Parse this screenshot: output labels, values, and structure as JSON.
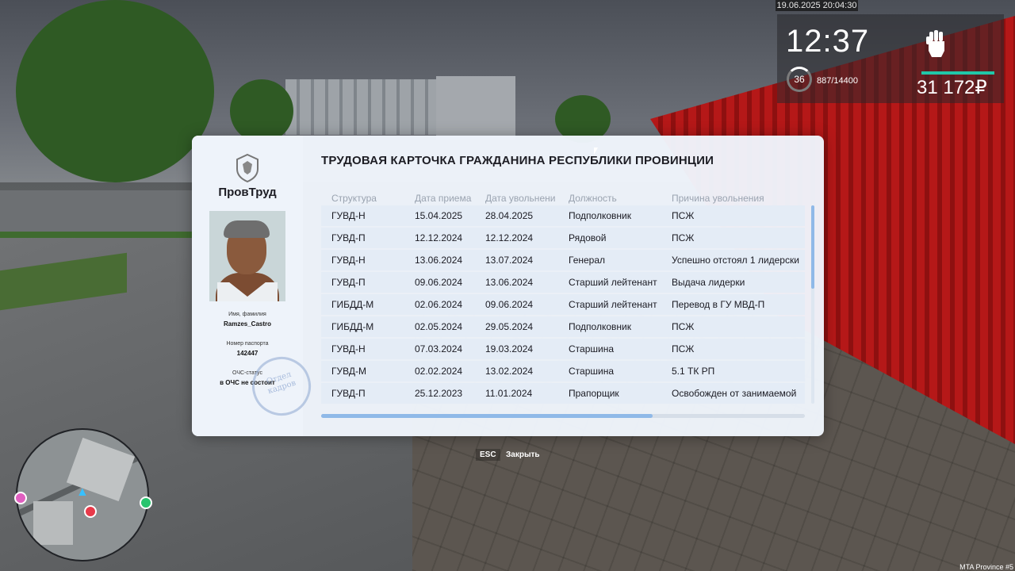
{
  "hud": {
    "datetime": "19.06.2025 20:04:30",
    "clock": "12:37",
    "level": "36",
    "exp": "887/14400",
    "money": "31 172₽"
  },
  "card": {
    "title": "ТРУДОВАЯ КАРТОЧКА ГРАЖДАНИНА РЕСПУБЛИКИ ПРОВИНЦИИ",
    "org": "ПровТруд",
    "name_label": "Имя, фамилия",
    "name_value": "Ramzes_Castro",
    "passport_label": "Номер паспорта",
    "passport_value": "142447",
    "ochs_label": "ОЧС-статус",
    "ochs_value": "в ОЧС не состоит",
    "stamp_line1": "Отдел",
    "stamp_line2": "кадров",
    "columns": [
      "Структура",
      "Дата приема",
      "Дата увольнени",
      "Должность",
      "Причина увольнения"
    ],
    "rows": [
      [
        "ГУВД-Н",
        "15.04.2025",
        "28.04.2025",
        "Подполковник",
        "ПСЖ"
      ],
      [
        "ГУВД-П",
        "12.12.2024",
        "12.12.2024",
        "Рядовой",
        "ПСЖ"
      ],
      [
        "ГУВД-Н",
        "13.06.2024",
        "13.07.2024",
        "Генерал",
        "Успешно отстоял 1 лидерски"
      ],
      [
        "ГУВД-П",
        "09.06.2024",
        "13.06.2024",
        "Старший лейтенант",
        "Выдача лидерки"
      ],
      [
        "ГИБДД-М",
        "02.06.2024",
        "09.06.2024",
        "Старший лейтенант",
        "Перевод в ГУ МВД-П"
      ],
      [
        "ГИБДД-М",
        "02.05.2024",
        "29.05.2024",
        "Подполковник",
        "ПСЖ"
      ],
      [
        "ГУВД-Н",
        "07.03.2024",
        "19.03.2024",
        "Старшина",
        "ПСЖ"
      ],
      [
        "ГУВД-М",
        "02.02.2024",
        "13.02.2024",
        "Старшина",
        "5.1 ТК РП"
      ],
      [
        "ГУВД-П",
        "25.12.2023",
        "11.01.2024",
        "Прапорщик",
        "Освобожден от занимаемой"
      ]
    ]
  },
  "footer": {
    "esc_key": "ESC",
    "esc_label": "Закрыть"
  },
  "server": "MTA Province #5",
  "colors": {
    "accent": "#8fb9e8",
    "hud_bar": "#21c7a8",
    "row_bg": "#e4ecf6"
  },
  "icons": [
    "coat-of-arms-icon",
    "fist-icon",
    "cursor-icon",
    "minimap-arrow-icon"
  ]
}
